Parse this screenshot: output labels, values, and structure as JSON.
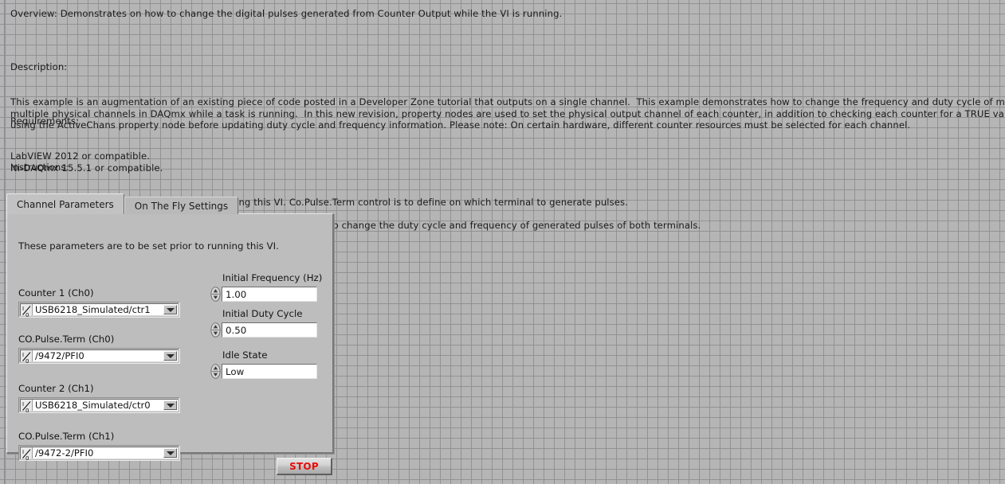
{
  "document": {
    "overview": "Overview: Demonstrates on how to change the digital pulses generated from Counter Output while the VI is running.",
    "description_heading": "Description:",
    "description_body": "This example is an augmentation of an existing piece of code posted in a Developer Zone tutorial that outputs on a single channel.  This example demonstrates how to change the frequency and duty cycle of multiple pulse trains on\nmultiple physical channels in DAQmx while a task is running.  In this new revision, property nodes are used to set the physical output channel of each counter, in addition to checking each counter for a TRUE value on RdyForNewVal\nusing the ActiveChans property node before updating duty cycle and frequency information. Please note: On certain hardware, different counter resources must be selected for each channel.",
    "requirements_heading": "Requirements:",
    "requirements_body": "LabVIEW 2012 or compatible.\nNi-DAQmx 15.5.1 or compatible.",
    "instructions_heading": "Instructions:",
    "instructions_body": "1. Specify the Channel Parameters prior to running this VI. Co.Pulse.Term control is to define on which terminal to generate pulses.\n2. Run this VI.\n3. You may regulate the controls under the On The Fly Settings tab to change the duty cycle and frequency of generated pulses of both terminals."
  },
  "tabs": {
    "items": [
      {
        "label": "Channel Parameters",
        "active": true
      },
      {
        "label": "On The Fly Settings",
        "active": false
      }
    ],
    "page_note": "These parameters are to be set prior to running this VI."
  },
  "channel_parameters": {
    "counter1": {
      "label": "Counter 1 (Ch0)",
      "value": "USB6218_Simulated/ctr1",
      "glyph": "io-channel-icon"
    },
    "co_pulse_term_ch0": {
      "label": "CO.Pulse.Term (Ch0)",
      "value": "/9472/PFI0",
      "glyph": "io-channel-icon"
    },
    "counter2": {
      "label": "Counter 2 (Ch1)",
      "value": "USB6218_Simulated/ctr0",
      "glyph": "io-channel-icon"
    },
    "co_pulse_term_ch1": {
      "label": "CO.Pulse.Term (Ch1)",
      "value": "/9472-2/PFI0",
      "glyph": "io-channel-icon"
    },
    "initial_frequency": {
      "label": "Initial Frequency (Hz)",
      "value": "1.00"
    },
    "initial_duty_cycle": {
      "label": "Initial Duty Cycle",
      "value": "0.50"
    },
    "idle_state": {
      "label": "Idle State",
      "value": "Low"
    }
  },
  "stop_button": {
    "label": "STOP"
  },
  "colors": {
    "panel_background": "#b5b5b5",
    "grid_line": "#8c8c8c",
    "tab_active": "#c2c2c2",
    "tab_inactive": "#b9b9b9",
    "tab_page": "#bdbdbd",
    "text": "#1a1a1a",
    "stop_text": "#ea0a0a",
    "field_background": "#ffffff"
  }
}
